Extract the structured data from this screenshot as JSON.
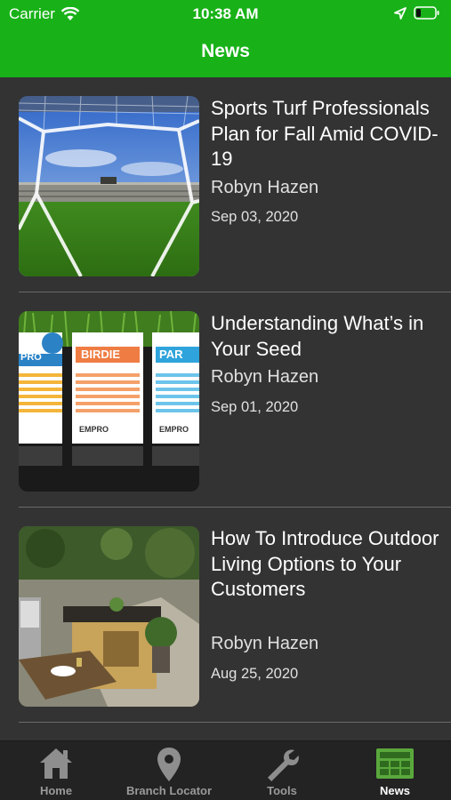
{
  "status_bar": {
    "carrier": "Carrier",
    "time": "10:38 AM",
    "icons": [
      "wifi-icon",
      "location-arrow-icon",
      "battery-icon"
    ]
  },
  "nav": {
    "title": "News"
  },
  "articles": [
    {
      "title": "Sports Turf Professionals Plan for Fall Amid COVID-19",
      "author": "Robyn Hazen",
      "date": "Sep 03, 2020",
      "image": "soccer-goal-stadium-image"
    },
    {
      "title": "Understanding What’s in Your Seed",
      "author": "Robyn Hazen",
      "date": "Sep 01, 2020",
      "image": "seed-bags-image",
      "image_text": {
        "bag1": "PRO",
        "bag2": "BIRDIE",
        "bag3": "PAR",
        "brand": "EMPRO"
      }
    },
    {
      "title": "How To Introduce Outdoor Living Options to Your Customers",
      "author": "Robyn Hazen",
      "date": "Aug 25, 2020",
      "image": "outdoor-kitchen-image"
    }
  ],
  "tabs": [
    {
      "label": "Home",
      "icon": "house-icon",
      "active": false
    },
    {
      "label": "Branch Locator",
      "icon": "map-pin-icon",
      "active": false
    },
    {
      "label": "Tools",
      "icon": "wrench-icon",
      "active": false
    },
    {
      "label": "News",
      "icon": "newspaper-icon",
      "active": true
    }
  ],
  "colors": {
    "header": "#18b218",
    "background": "#333333",
    "tab_bar": "#232323",
    "active_icon": "#5aa83c"
  }
}
